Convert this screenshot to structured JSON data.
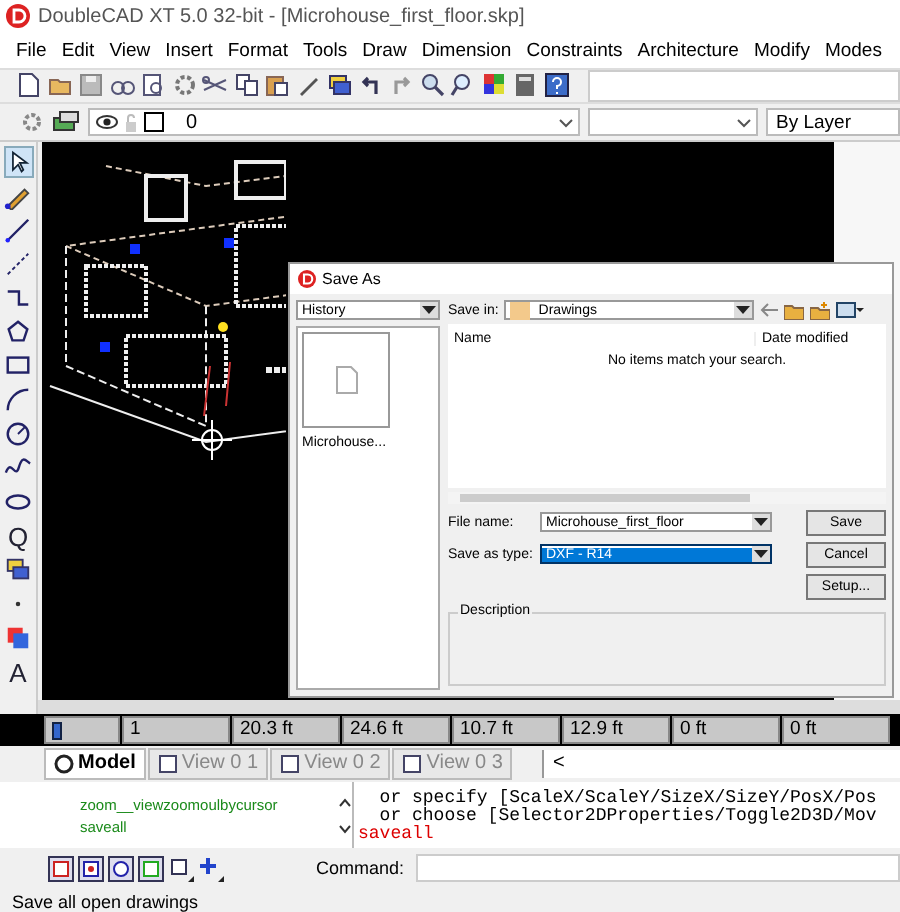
{
  "window": {
    "title": "DoubleCAD XT 5.0 32-bit - [Microhouse_first_floor.skp]"
  },
  "menu": [
    "File",
    "Edit",
    "View",
    "Insert",
    "Format",
    "Tools",
    "Draw",
    "Dimension",
    "Constraints",
    "Architecture",
    "Modify",
    "Modes"
  ],
  "layer_bar": {
    "layer": "0",
    "linetype": "By Layer"
  },
  "left_toolbar": [
    {
      "kind": "select",
      "selected": true
    },
    {
      "kind": "pencil",
      "selected": false
    },
    {
      "kind": "line",
      "selected": false
    },
    {
      "kind": "dotline",
      "selected": false
    },
    {
      "kind": "polyline",
      "selected": false
    },
    {
      "kind": "polygon",
      "selected": false
    },
    {
      "kind": "rect",
      "selected": false
    },
    {
      "kind": "arc",
      "selected": false
    },
    {
      "kind": "circle",
      "selected": false
    },
    {
      "kind": "curve",
      "selected": false
    },
    {
      "kind": "ellipse",
      "selected": false
    },
    {
      "kind": "letter",
      "label": "Q",
      "selected": false
    },
    {
      "kind": "layers",
      "selected": false
    },
    {
      "kind": "dot",
      "selected": false
    },
    {
      "kind": "fill",
      "selected": false
    },
    {
      "kind": "letter",
      "label": "A",
      "selected": false
    }
  ],
  "dialog": {
    "title": "Save As",
    "places": "History",
    "recent_file": "Microhouse...",
    "save_in_label": "Save in:",
    "save_in": "Drawings",
    "columns": [
      "Name",
      "Date modified"
    ],
    "empty_message": "No items match your search.",
    "file_name_label": "File name:",
    "file_name": "Microhouse_first_floor",
    "type_label": "Save as type:",
    "type": "DXF  - R14",
    "type_selected": true,
    "buttons": [
      "Save",
      "Cancel",
      "Setup..."
    ],
    "description_label": "Description"
  },
  "status_cells": [
    "",
    "1",
    "20.3 ft",
    "24.6 ft",
    "10.7 ft",
    "12.9 ft",
    "0 ft",
    "0 ft"
  ],
  "tabs": [
    {
      "label": "Model",
      "selected": true
    },
    {
      "label": "View 0 1",
      "selected": false
    },
    {
      "label": "View 0 2",
      "selected": false
    },
    {
      "label": "View 0 3",
      "selected": false
    }
  ],
  "tabs_scroll": "<",
  "history": [
    "zoom__viewzoomoulbycursor",
    "saveall"
  ],
  "console": [
    {
      "kind": "echo",
      "text": "  or specify [ScaleX/ScaleY/SizeX/SizeY/PosX/Pos"
    },
    {
      "kind": "echo",
      "text": "  or choose [Selector2DProperties/Toggle2D3D/Mov"
    },
    {
      "kind": "input",
      "text": "saveall"
    }
  ],
  "command": {
    "label": "Command:"
  },
  "status_bar": "Save all open drawings"
}
